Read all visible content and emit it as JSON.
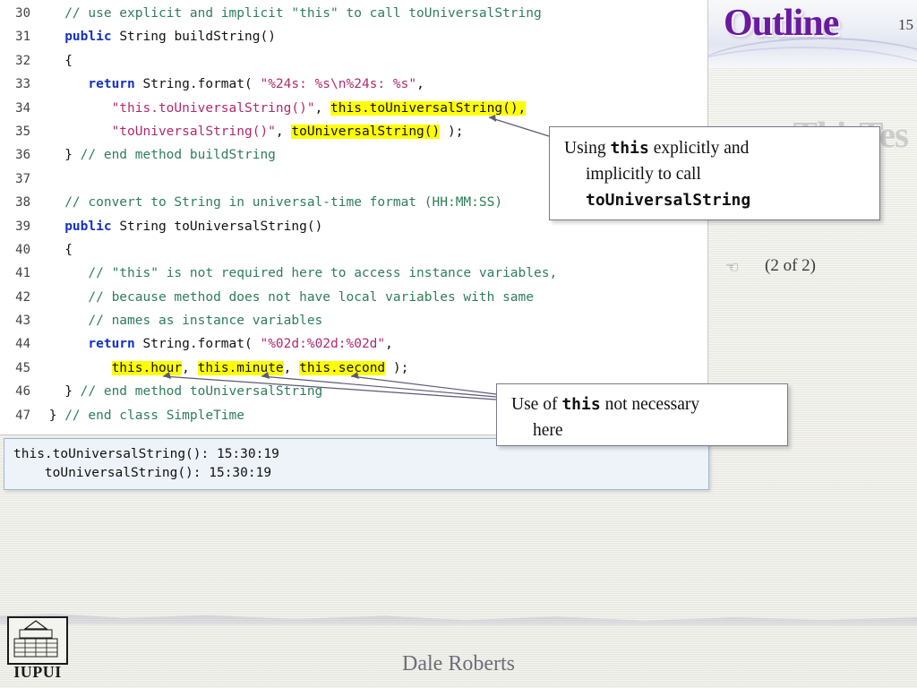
{
  "slide": {
    "title": "Outline",
    "number": "15",
    "ghost_heading": "e ThisTes",
    "part_indicator": "(2 of 2)",
    "footer": "Dale Roberts",
    "logo_label": "IUPUI"
  },
  "code": {
    "lines": [
      {
        "n": "30",
        "tokens": [
          {
            "t": "   ",
            "c": "pln"
          },
          {
            "t": "// use explicit and implicit \"this\" to call toUniversalString",
            "c": "cmt"
          }
        ]
      },
      {
        "n": "31",
        "tokens": [
          {
            "t": "   ",
            "c": "pln"
          },
          {
            "t": "public",
            "c": "kw"
          },
          {
            "t": " ",
            "c": "pln"
          },
          {
            "t": "String",
            "c": "pln"
          },
          {
            "t": " buildString()",
            "c": "pln"
          }
        ]
      },
      {
        "n": "32",
        "tokens": [
          {
            "t": "   {",
            "c": "pln"
          }
        ]
      },
      {
        "n": "33",
        "tokens": [
          {
            "t": "      ",
            "c": "pln"
          },
          {
            "t": "return",
            "c": "kw"
          },
          {
            "t": " String.format( ",
            "c": "pln"
          },
          {
            "t": "\"%24s: %s\\n%24s: %s\"",
            "c": "str"
          },
          {
            "t": ",",
            "c": "pln"
          }
        ]
      },
      {
        "n": "34",
        "tokens": [
          {
            "t": "         ",
            "c": "pln"
          },
          {
            "t": "\"this.toUniversalString()\"",
            "c": "str"
          },
          {
            "t": ", ",
            "c": "pln"
          },
          {
            "t": "this.toUniversalString(),",
            "c": "hl"
          }
        ]
      },
      {
        "n": "35",
        "tokens": [
          {
            "t": "         ",
            "c": "pln"
          },
          {
            "t": "\"toUniversalString()\"",
            "c": "str"
          },
          {
            "t": ", ",
            "c": "pln"
          },
          {
            "t": "toUniversalString()",
            "c": "hl"
          },
          {
            "t": " );",
            "c": "pln"
          }
        ]
      },
      {
        "n": "36",
        "tokens": [
          {
            "t": "   } ",
            "c": "pln"
          },
          {
            "t": "// end method buildString",
            "c": "cmt"
          }
        ]
      },
      {
        "n": "37",
        "tokens": [
          {
            "t": "",
            "c": "pln"
          }
        ]
      },
      {
        "n": "38",
        "tokens": [
          {
            "t": "   ",
            "c": "pln"
          },
          {
            "t": "// convert to String in universal-time format (HH:MM:SS)",
            "c": "cmt"
          }
        ]
      },
      {
        "n": "39",
        "tokens": [
          {
            "t": "   ",
            "c": "pln"
          },
          {
            "t": "public",
            "c": "kw"
          },
          {
            "t": " String toUniversalString()",
            "c": "pln"
          }
        ]
      },
      {
        "n": "40",
        "tokens": [
          {
            "t": "   {",
            "c": "pln"
          }
        ]
      },
      {
        "n": "41",
        "tokens": [
          {
            "t": "      ",
            "c": "pln"
          },
          {
            "t": "// \"this\" is not required here to access instance variables,",
            "c": "cmt"
          }
        ]
      },
      {
        "n": "42",
        "tokens": [
          {
            "t": "      ",
            "c": "pln"
          },
          {
            "t": "// because method does not have local variables with same",
            "c": "cmt"
          }
        ]
      },
      {
        "n": "43",
        "tokens": [
          {
            "t": "      ",
            "c": "pln"
          },
          {
            "t": "// names as instance variables",
            "c": "cmt"
          }
        ]
      },
      {
        "n": "44",
        "tokens": [
          {
            "t": "      ",
            "c": "pln"
          },
          {
            "t": "return",
            "c": "kw"
          },
          {
            "t": " String.format( ",
            "c": "pln"
          },
          {
            "t": "\"%02d:%02d:%02d\"",
            "c": "str"
          },
          {
            "t": ",",
            "c": "pln"
          }
        ]
      },
      {
        "n": "45",
        "tokens": [
          {
            "t": "         ",
            "c": "pln"
          },
          {
            "t": "this.hour",
            "c": "hl"
          },
          {
            "t": ", ",
            "c": "pln"
          },
          {
            "t": "this.minute",
            "c": "hl"
          },
          {
            "t": ", ",
            "c": "pln"
          },
          {
            "t": "this.second",
            "c": "hl"
          },
          {
            "t": " );",
            "c": "pln"
          }
        ]
      },
      {
        "n": "46",
        "tokens": [
          {
            "t": "   } ",
            "c": "pln"
          },
          {
            "t": "// end method toUniversalString",
            "c": "cmt"
          }
        ]
      },
      {
        "n": "47",
        "tokens": [
          {
            "t": " } ",
            "c": "pln"
          },
          {
            "t": "// end class SimpleTime",
            "c": "cmt"
          }
        ]
      }
    ]
  },
  "output": {
    "text": "this.toUniversalString(): 15:30:19\n    toUniversalString(): 15:30:19"
  },
  "callouts": {
    "one": {
      "line1_a": "Using ",
      "line1_mono": "this",
      "line1_b": " explicitly and",
      "line2": "implicitly to call",
      "line3_mono": "toUniversalString"
    },
    "two": {
      "line1_a": "Use of ",
      "line1_mono": "this",
      "line1_b": " not necessary",
      "line2": "here"
    }
  },
  "colors": {
    "title": "#6a1aa0",
    "keyword": "#1431c2",
    "comment": "#2e7d5b",
    "string": "#b02a6e",
    "highlight": "#ffff00",
    "output_bg": "#eef3fa"
  }
}
